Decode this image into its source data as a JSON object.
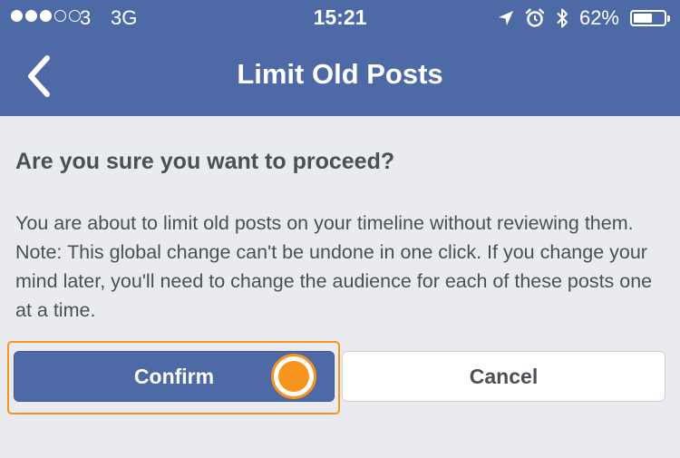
{
  "status_bar": {
    "carrier": "3",
    "network": "3G",
    "time": "15:21",
    "battery_percent": "62%",
    "battery_level": 0.62,
    "signal_filled": 3,
    "signal_total": 5,
    "icons": [
      "location-arrow-icon",
      "alarm-icon",
      "bluetooth-icon",
      "battery-icon"
    ]
  },
  "nav": {
    "title": "Limit Old Posts",
    "back_icon": "chevron-left-icon"
  },
  "dialog": {
    "question": "Are you sure you want to proceed?",
    "description": "You are about to limit old posts on your timeline without reviewing them. Note: This global change can't be undone in one click. If you change your mind later, you'll need to change the audience for each of these posts one at a time.",
    "confirm_label": "Confirm",
    "cancel_label": "Cancel"
  },
  "colors": {
    "header_blue": "#4d69a6",
    "background": "#e9ebee",
    "text": "#4b4f56",
    "highlight_orange": "#f7941d"
  }
}
